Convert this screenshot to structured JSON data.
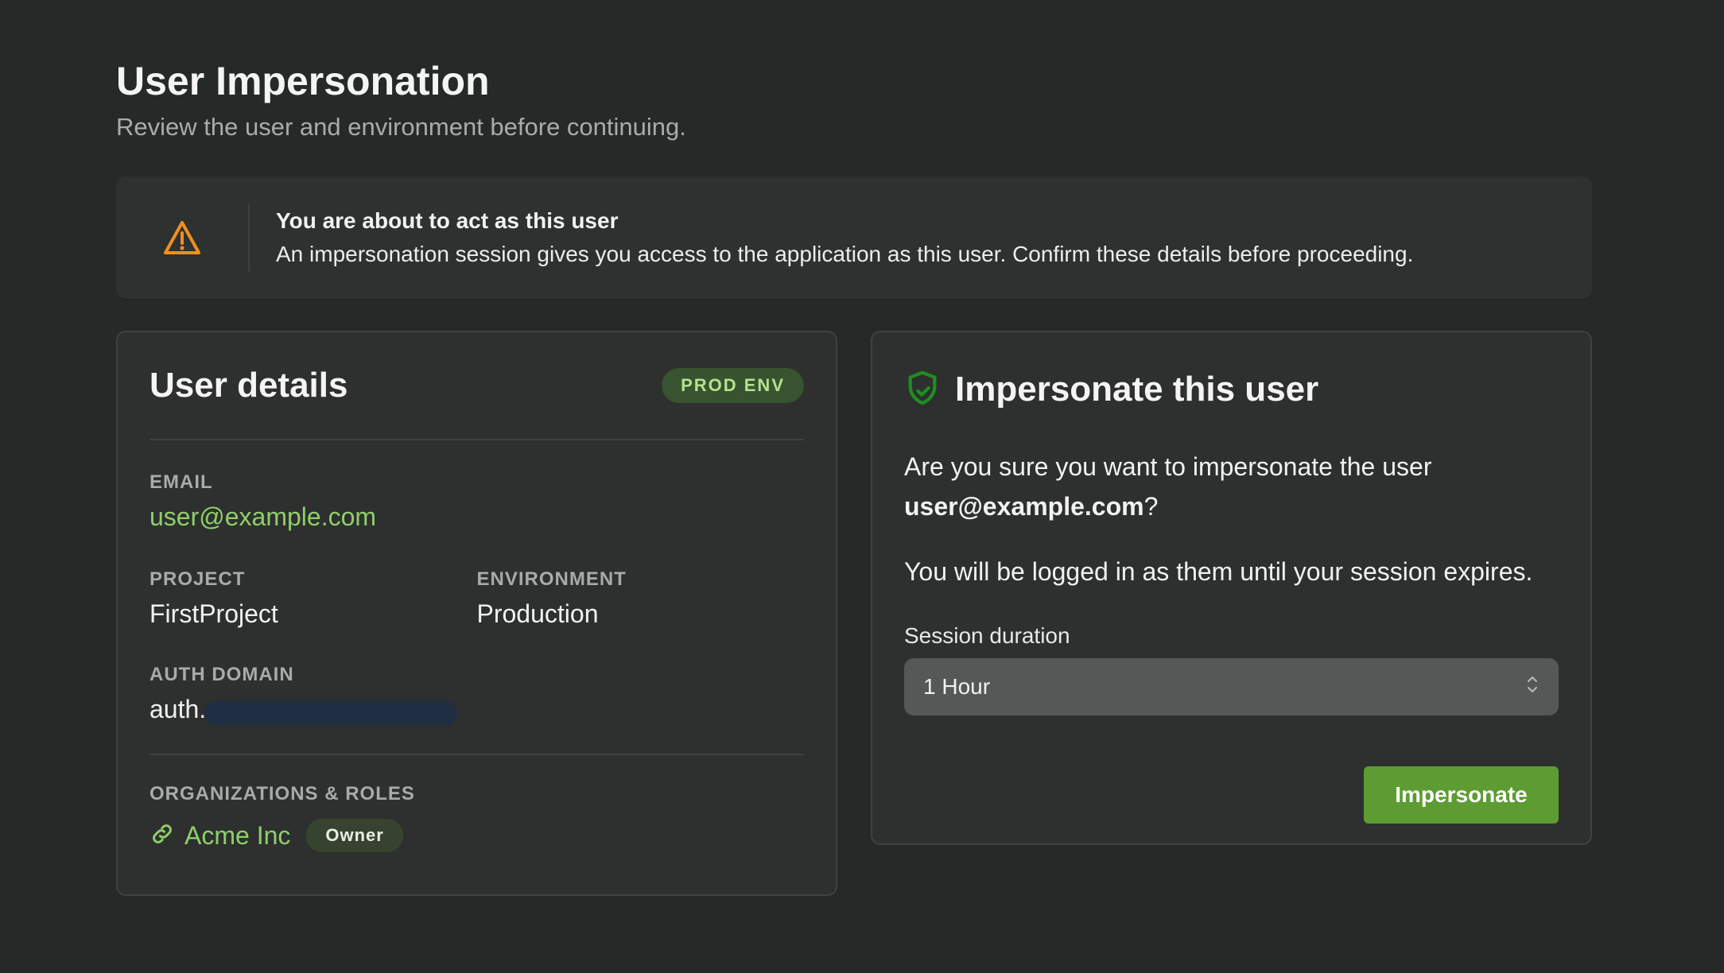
{
  "page": {
    "title": "User Impersonation",
    "subtitle": "Review the user and environment before continuing."
  },
  "alert": {
    "icon": "warning-triangle-icon",
    "title": "You are about to act as this user",
    "body": "An impersonation session gives you access to the application as this user. Confirm these details before proceeding."
  },
  "user_details": {
    "title": "User details",
    "env_badge": "PROD ENV",
    "email_label": "EMAIL",
    "email_value": "user@example.com",
    "project_label": "PROJECT",
    "project_value": "FirstProject",
    "environment_label": "ENVIRONMENT",
    "environment_value": "Production",
    "auth_domain_label": "AUTH DOMAIN",
    "auth_domain_prefix": "auth.",
    "orgs_label": "ORGANIZATIONS & ROLES",
    "orgs": [
      {
        "name": "Acme Inc",
        "role": "Owner"
      }
    ]
  },
  "impersonate": {
    "title": "Impersonate this user",
    "question_pre": "Are you sure you want to impersonate the user",
    "question_email": "user@example.com",
    "question_post": "?",
    "note": "You will be logged in as them until your session expires.",
    "duration_label": "Session duration",
    "duration_value": "1 Hour",
    "button_label": "Impersonate"
  },
  "colors": {
    "accent_green": "#8fcf6a",
    "button_green": "#5d9c32",
    "warning_orange": "#f0901f",
    "background": "#252927"
  }
}
